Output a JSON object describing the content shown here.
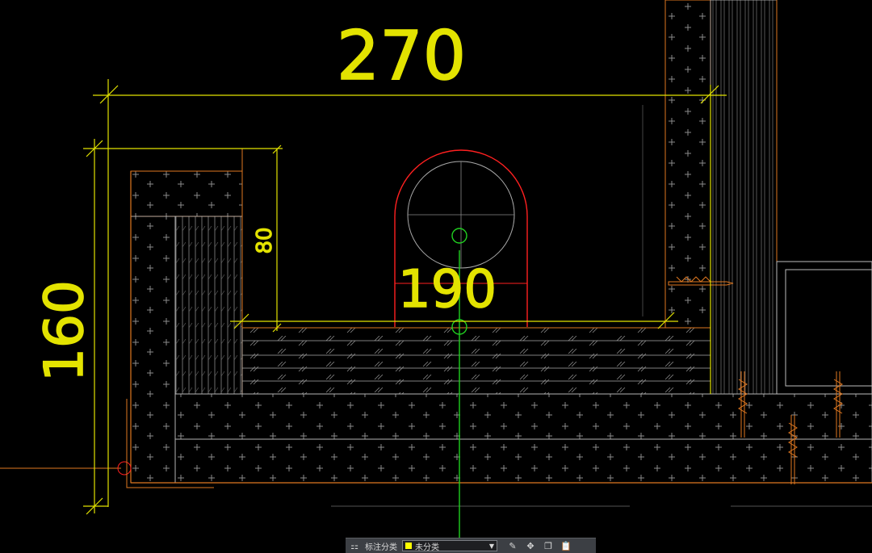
{
  "drawing": {
    "dimensions": [
      {
        "id": "top-width",
        "text": "270"
      },
      {
        "id": "left-height",
        "text": "160"
      },
      {
        "id": "step-height",
        "text": "80"
      },
      {
        "id": "pipe-width",
        "text": "190"
      }
    ]
  },
  "toolbar": {
    "label": "标注分类",
    "selected_category": "未分类",
    "swatch_color": "#ffff00",
    "icons": [
      "category-grid-icon",
      "edit-icon",
      "move-icon",
      "copy-icon",
      "paste-icon"
    ]
  },
  "colors": {
    "background": "#000000",
    "dimension": "#e3e300",
    "wall_outline": "#e07820",
    "pipe": "#ff2020",
    "centerline": "#20d020",
    "hatch": "#9a9a9a"
  }
}
